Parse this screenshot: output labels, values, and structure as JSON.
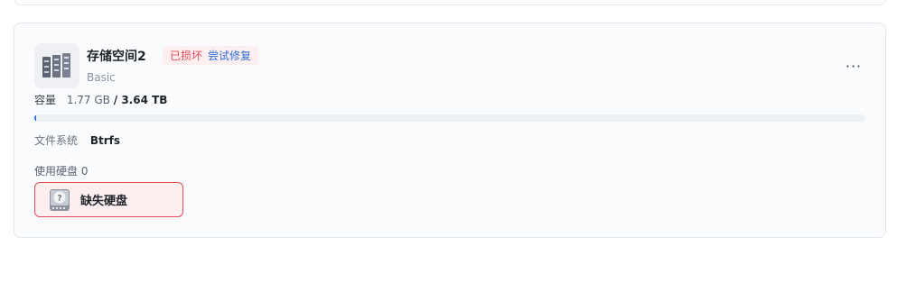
{
  "pool": {
    "name": "存储空间2",
    "status": "已损坏",
    "repair_link": "尝试修复",
    "raid_type": "Basic",
    "capacity_label": "容量",
    "used": "1.77 GB",
    "separator": "/",
    "total": "3.64 TB",
    "used_fraction": 0.0005,
    "filesystem_label": "文件系统",
    "filesystem": "Btrfs",
    "disks_label": "使用硬盘 0",
    "missing_disk_label": "缺失硬盘",
    "more_menu": "···"
  },
  "icons": {
    "pool": "disk-array-icon",
    "missing_disk": "missing-disk-icon"
  },
  "colors": {
    "danger": "#e34d59",
    "danger_bg": "#fdeff0",
    "accent": "#2f6fd6"
  }
}
